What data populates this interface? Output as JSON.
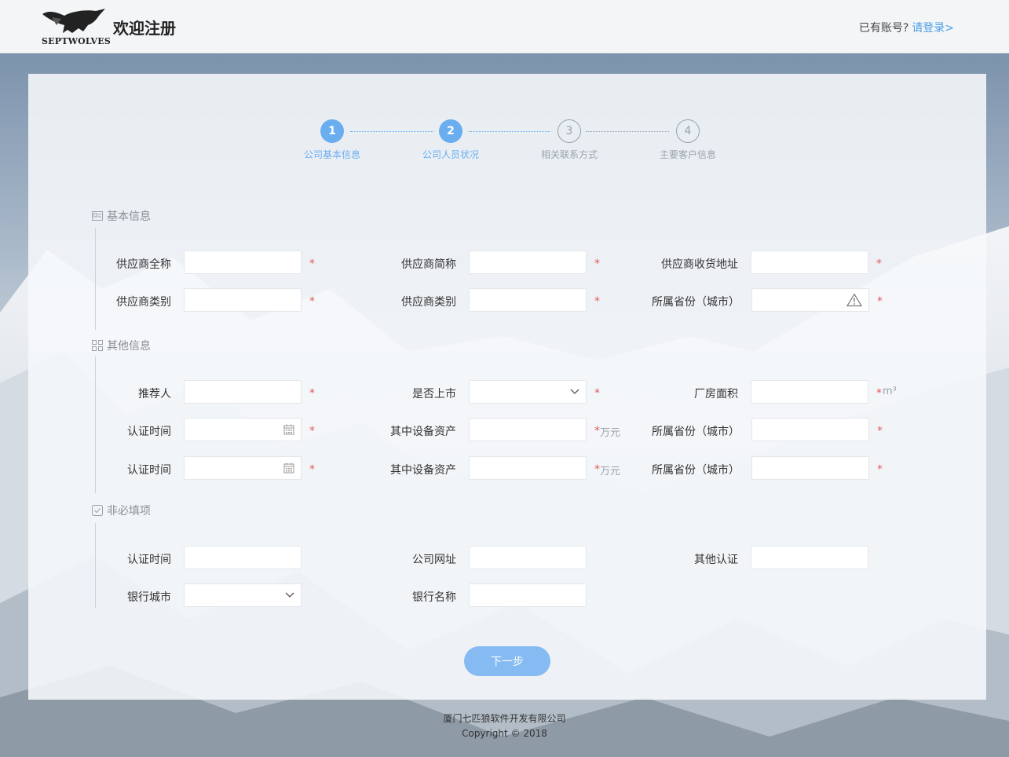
{
  "header": {
    "brand": "SEPTWOLVES",
    "title": "欢迎注册",
    "has_account": "已有账号?",
    "login_link": "请登录>"
  },
  "steps": [
    {
      "num": "1",
      "label": "公司基本信息",
      "state": "active"
    },
    {
      "num": "2",
      "label": "公司人员状况",
      "state": "active"
    },
    {
      "num": "3",
      "label": "相关联系方式",
      "state": "inactive"
    },
    {
      "num": "4",
      "label": "主要客户信息",
      "state": "inactive"
    }
  ],
  "sections": {
    "basic": "基本信息",
    "other": "其他信息",
    "optional": "非必填项"
  },
  "fields": {
    "supplier_full_name": "供应商全称",
    "supplier_short_name": "供应商简称",
    "supplier_address": "供应商收货地址",
    "supplier_category_1": "供应商类别",
    "supplier_category_2": "供应商类别",
    "province_1": "所属省份（城市）",
    "referrer": "推荐人",
    "listed": "是否上市",
    "factory_area": "厂房面积",
    "cert_time_1": "认证时间",
    "equipment_assets_1": "其中设备资产",
    "province_2": "所属省份（城市）",
    "cert_time_2": "认证时间",
    "equipment_assets_2": "其中设备资产",
    "province_3": "所属省份（城市）",
    "cert_time_3": "认证时间",
    "company_website": "公司网址",
    "other_cert": "其他认证",
    "bank_city": "银行城市",
    "bank_name": "银行名称"
  },
  "units": {
    "area": "m³",
    "wan_yuan": "万元"
  },
  "required_mark": "*",
  "next_button": "下一步",
  "footer": {
    "company": "厦门七匹狼软件开发有限公司",
    "copyright": "Copyright © 2018"
  },
  "colors": {
    "accent": "#6aaef0",
    "required": "#e05b5b",
    "button": "#86baf2"
  }
}
